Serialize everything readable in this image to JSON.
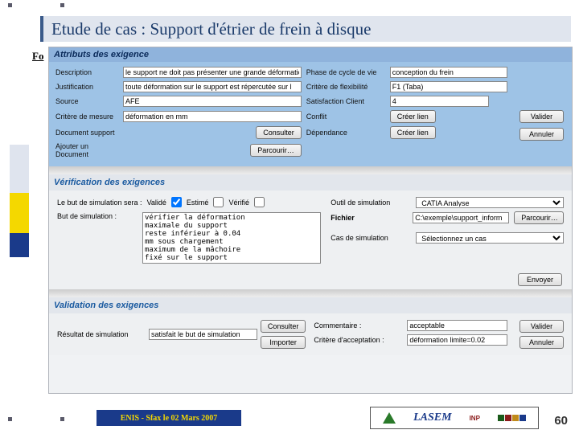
{
  "slide": {
    "title": "Etude de cas :  Support d'étrier de frein à disque",
    "fo": "Fo",
    "footer_enis": "ENIS - Sfax le 02 Mars 2007",
    "lasem": "LASEM",
    "page_num": "60"
  },
  "attributs": {
    "heading": "Attributs des exigence",
    "labels": {
      "description": "Description",
      "justification": "Justification",
      "source": "Source",
      "critere_mesure": "Critère de mesure",
      "doc_support": "Document support",
      "ajouter_doc": "Ajouter un Document",
      "phase": "Phase de cycle de vie",
      "critere_flex": "Critère de flexibilité",
      "satisfaction": "Satisfaction Client",
      "conflit": "Conflit",
      "dependance": "Dépendance"
    },
    "values": {
      "description": "le support ne doit pas présenter une grande déformation",
      "justification": "toute déformation sur le support est répercutée sur l",
      "source": "AFE",
      "critere_mesure": "déformation en mm",
      "phase": "conception du frein",
      "critere_flex": "F1 (Taba)",
      "satisfaction": "4"
    },
    "buttons": {
      "consulter": "Consulter",
      "parcourir": "Parcourir…",
      "creer1": "Créer lien",
      "creer2": "Créer lien",
      "valider": "Valider",
      "annuler": "Annuler"
    }
  },
  "verification": {
    "heading": "Vérification des exigences",
    "but_line": "Le but de simulation sera :",
    "valide": "Validé",
    "estime": "Estimé",
    "verifie": "Vérifié",
    "but_label": "But de simulation :",
    "but_text": "vérifier la déformation\nmaximale du support\nreste inférieur à 0.04\nmm sous chargement\nmaximum de la mâchoire\nfixé sur le support",
    "outil_label": "Outil de simulation",
    "outil_value": "CATIA Analyse",
    "fichier_label": "Fichier",
    "fichier_value": "C:\\exemple\\support_inform",
    "parcourir": "Parcourir…",
    "cas_label": "Cas de simulation",
    "cas_value": "Sélectionnez un cas",
    "envoyer": "Envoyer"
  },
  "validation": {
    "heading": "Validation des exigences",
    "resultat_label": "Résultat de simulation",
    "resultat_value": "satisfait le but de simulation",
    "consulter": "Consulter",
    "importer": "Importer",
    "commentaire_label": "Commentaire :",
    "commentaire_value": "acceptable",
    "critere_label": "Critère d'acceptation :",
    "critere_value": "déformation limite=0.02",
    "valider": "Valider",
    "annuler": "Annuler"
  }
}
